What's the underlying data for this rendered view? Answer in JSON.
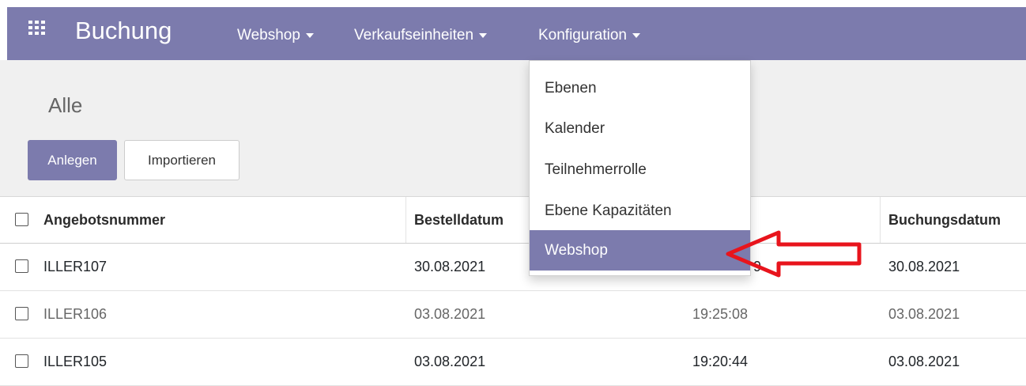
{
  "navbar": {
    "brand": "Buchung",
    "menus": [
      {
        "label": "Webshop"
      },
      {
        "label": "Verkaufseinheiten"
      },
      {
        "label": "Konfiguration"
      }
    ]
  },
  "control_panel": {
    "title": "Alle",
    "create_label": "Anlegen",
    "import_label": "Importieren"
  },
  "table": {
    "columns": [
      "Angebotsnummer",
      "Bestelldatum",
      "Buchungsdatum"
    ],
    "rows": [
      {
        "name": "ILLER107",
        "bestelldatum": "30.08.2021",
        "time": "9",
        "buchungsdatum": "30.08.2021"
      },
      {
        "name": "ILLER106",
        "bestelldatum": "03.08.2021",
        "time": "19:25:08",
        "buchungsdatum": "03.08.2021"
      },
      {
        "name": "ILLER105",
        "bestelldatum": "03.08.2021",
        "time": "19:20:44",
        "buchungsdatum": "03.08.2021"
      }
    ]
  },
  "dropdown": {
    "items": [
      {
        "label": "Ebenen"
      },
      {
        "label": "Kalender"
      },
      {
        "label": "Teilnehmerrolle"
      },
      {
        "label": "Ebene Kapazitäten"
      },
      {
        "label": "Webshop"
      }
    ],
    "active_item": "Webshop"
  },
  "colors": {
    "brand": "#7c7bad",
    "annotation": "#e8141c"
  },
  "icons": {
    "apps": "apps-grid-icon",
    "caret": "caret-down-icon",
    "checkbox": "checkbox-icon",
    "annotation": "red-arrow-icon"
  }
}
